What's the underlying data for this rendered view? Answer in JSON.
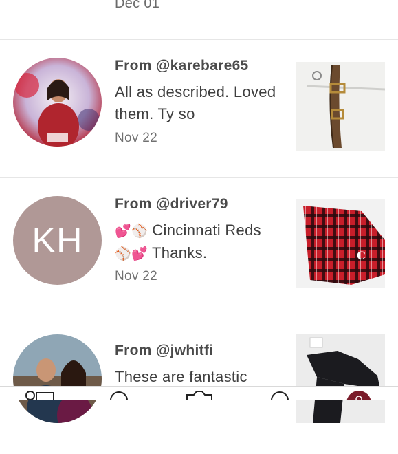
{
  "top_partial_date": "Dec 01",
  "reviews": [
    {
      "from": "From @karebare65",
      "comment": "All as described. Loved them. Ty so",
      "date": "Nov 22",
      "avatar_type": "photo",
      "item": "belt"
    },
    {
      "from": "From @driver79",
      "comment_parts": [
        "💕",
        "⚾",
        " Cincinnati Reds ",
        "⚾",
        "💕",
        " Thanks."
      ],
      "date": "Nov 22",
      "avatar_type": "initials",
      "avatar_initials": "KH",
      "avatar_color": "#b09896",
      "item": "plaid-pants"
    },
    {
      "from": "From @jwhitfi",
      "comment": "These are fantastic",
      "date": "",
      "avatar_type": "photo",
      "item": "gloves"
    }
  ],
  "tabbar": {
    "icons": [
      "closet-icon",
      "search-icon",
      "camera-icon",
      "chat-icon",
      "profile-icon"
    ],
    "accent": "#7a1c2a"
  }
}
